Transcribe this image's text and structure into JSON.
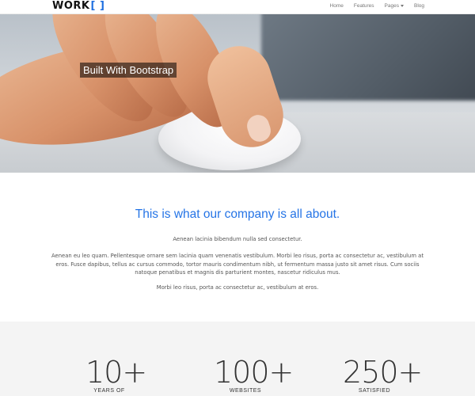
{
  "navbar": {
    "logo": "WORK",
    "logo_bracket": "[ ]",
    "items": [
      {
        "label": "Home"
      },
      {
        "label": "Features"
      },
      {
        "label": "Pages"
      },
      {
        "label": "Blog"
      }
    ]
  },
  "hero": {
    "title": "Built With Bootstrap"
  },
  "about": {
    "heading": "This is what our company is all about.",
    "para1": "Aenean lacinia bibendum nulla sed consectetur.",
    "para2": "Aenean eu leo quam. Pellentesque ornare sem lacinia quam venenatis vestibulum. Morbi leo risus, porta ac consectetur ac, vestibulum at eros. Fusce dapibus, tellus ac cursus commodo, tortor mauris condimentum nibh, ut fermentum massa justo sit amet risus. Cum sociis natoque penatibus et magnis dis parturient montes, nascetur ridiculus mus.",
    "para3": "Morbi leo risus, porta ac consectetur ac, vestibulum at eros."
  },
  "stats": [
    {
      "number": "10+",
      "label": "YEARS OF"
    },
    {
      "number": "100+",
      "label": "WEBSITES"
    },
    {
      "number": "250+",
      "label": "SATISFIED"
    }
  ],
  "colors": {
    "accent": "#2574e6",
    "stats_bg": "#f4f4f4"
  }
}
